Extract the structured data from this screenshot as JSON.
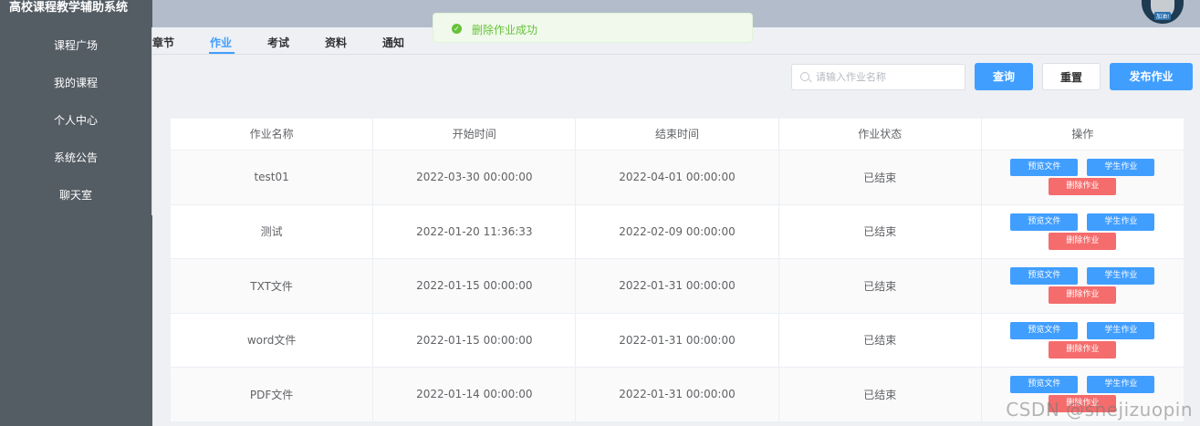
{
  "app": {
    "title": "高校课程教学辅助系统"
  },
  "sidebar": {
    "items": [
      {
        "label": "课程广场"
      },
      {
        "label": "我的课程"
      },
      {
        "label": "个人中心"
      },
      {
        "label": "系统公告"
      },
      {
        "label": "聊天室"
      }
    ]
  },
  "header": {
    "avatar_tag": "加油!"
  },
  "tabs": [
    {
      "label": "章节",
      "active": false
    },
    {
      "label": "作业",
      "active": true
    },
    {
      "label": "考试",
      "active": false
    },
    {
      "label": "资料",
      "active": false
    },
    {
      "label": "通知",
      "active": false
    }
  ],
  "toast": {
    "message": "删除作业成功",
    "type": "success"
  },
  "toolbar": {
    "search_placeholder": "请输入作业名称",
    "query_label": "查询",
    "reset_label": "重置",
    "publish_label": "发布作业"
  },
  "table": {
    "headers": [
      "作业名称",
      "开始时间",
      "结束时间",
      "作业状态",
      "操作"
    ],
    "rows": [
      {
        "name": "test01",
        "start": "2022-03-30 00:00:00",
        "end": "2022-04-01 00:00:00",
        "status": "已结束"
      },
      {
        "name": "测试",
        "start": "2022-01-20 11:36:33",
        "end": "2022-02-09 00:00:00",
        "status": "已结束"
      },
      {
        "name": "TXT文件",
        "start": "2022-01-15 00:00:00",
        "end": "2022-01-31 00:00:00",
        "status": "已结束"
      },
      {
        "name": "word文件",
        "start": "2022-01-15 00:00:00",
        "end": "2022-01-31 00:00:00",
        "status": "已结束"
      },
      {
        "name": "PDF文件",
        "start": "2022-01-14 00:00:00",
        "end": "2022-01-31 00:00:00",
        "status": "已结束"
      }
    ],
    "actions": {
      "preview": "预览文件",
      "students": "学生作业",
      "delete": "删除作业"
    }
  },
  "watermark": "CSDN @shejizuopin",
  "colors": {
    "primary": "#409eff",
    "danger": "#f56c6c",
    "success": "#67c23a",
    "sidebar": "#545c64"
  }
}
